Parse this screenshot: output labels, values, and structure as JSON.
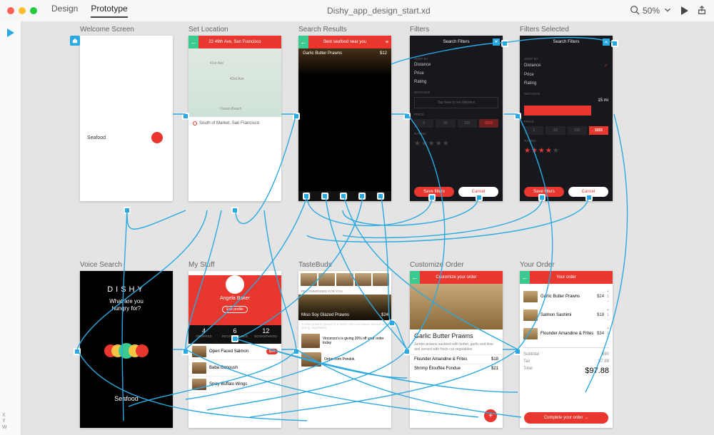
{
  "toolbar": {
    "tab_design": "Design",
    "tab_prototype": "Prototype",
    "doc_title": "Dishy_app_design_start.xd",
    "zoom": "50%"
  },
  "sidebar": {
    "x_label": "X",
    "y_label": "Y",
    "w_label": "W"
  },
  "artboards": {
    "welcome": {
      "label": "Welcome Screen",
      "text": "Seafood"
    },
    "location": {
      "label": "Set Location",
      "header": "22 49th Ave, San Francisco",
      "st1": "41st Ave",
      "st2": "43rd Ave",
      "beach": "Ocean Beach",
      "pin": "South of Market, San Francisco"
    },
    "results": {
      "label": "Search Results",
      "header": "Best seafood near you",
      "item_name": "Garlic Butter Prawns",
      "item_price": "$12"
    },
    "filters": {
      "label": "Filters",
      "header": "Search Filters",
      "sort": "SORT BY",
      "r1": "Distance",
      "r2": "Price",
      "r3": "Rating",
      "dsec": "DISTANCE",
      "dist_hint": "Tap here to set distance",
      "psec": "PRICE",
      "p1": "$",
      "p2": "$$",
      "p3": "$$$",
      "p4": "$$$$",
      "rsec": "RATING",
      "save": "Save filters",
      "cancel": "Cancel"
    },
    "filters2": {
      "label": "Filters Selected",
      "header": "Search Filters",
      "sort": "SORT BY",
      "r1": "Distance",
      "r2": "Price",
      "r3": "Rating",
      "dsec": "DISTANCE",
      "dist_val": "15 mi",
      "psec": "PRICE",
      "p1": "$",
      "p2": "$$",
      "p3": "$$$",
      "p4": "$$$$",
      "rsec": "RATING",
      "save": "Save filters",
      "cancel": "Cancel"
    },
    "voice": {
      "label": "Voice Search",
      "logo": "DISHY",
      "q": "What are you\nhungry for?",
      "res": "Seafood"
    },
    "mystuff": {
      "label": "My Stuff",
      "name": "Angela Baker",
      "edit": "Edit profile",
      "s1n": "4",
      "s1l": "ORDERED",
      "s2n": "6",
      "s2l": "RECOMMENDED",
      "s3n": "12",
      "s3l": "BOOKMARKED",
      "items": [
        "Open Faced Salmon",
        "Baba Ganoush",
        "Spicy Buffalo Wings"
      ]
    },
    "tastebuds": {
      "label": "TasteBuds",
      "sec": "RECOMMENDED FOR YOU",
      "f_name": "Miso Soy Glazed Prawns",
      "f_price": "$24",
      "sub": "Jumbo prawns glazed in a zesty miso soy sauce served with spring vegetables",
      "row1": "Vincenzo's is giving 20% off your order today",
      "row2": "Order from Pondok"
    },
    "customize": {
      "label": "Customize Order",
      "header": "Customize your order",
      "title": "Garlic Butter Prawns",
      "desc": "Jumbo prawns sautéed with butter, garlic and lime and served with fresh-cut vegetables",
      "l1n": "Flounder Amandine & Frites",
      "l1p": "$18",
      "l2n": "Shrimp Étouffée Fondue",
      "l2p": "$21"
    },
    "order": {
      "label": "Your Order",
      "header": "Your order",
      "items": [
        {
          "name": "Garlic Butter Prawns",
          "price": "$24"
        },
        {
          "name": "Salmon Sashimi",
          "price": "$18"
        },
        {
          "name": "Flounder Amandine & Frites",
          "price": "$34"
        }
      ],
      "sub_l": "Subtotal",
      "sub_v": "$90",
      "tax_l": "Tax",
      "tax_v": "$7.88",
      "tot_l": "Total",
      "tot_v": "$97.88",
      "cta": "Complete your order   →"
    }
  }
}
